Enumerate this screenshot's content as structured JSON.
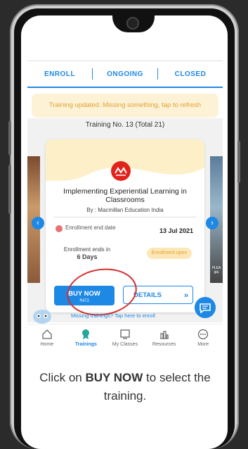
{
  "tabs": {
    "enroll": "ENROLL",
    "ongoing": "ONGOING",
    "closed": "CLOSED"
  },
  "banner": "Training updated. Missing something, tap to refresh",
  "training_no": "Training No. 13 (Total 21)",
  "card": {
    "logo_text": "macmillan education",
    "title": "Implementing Experiential Learning in Classrooms",
    "by": "By : Macmillan Education India",
    "end_label": "Enrollment end date",
    "end_date": "13 Jul 2021",
    "ends_in": "Enrollment ends in",
    "ends_days": "6 Days",
    "status_badge": "Enrollment open",
    "buy_label": "BUY NOW",
    "buy_price": "₹472",
    "details_label": "DETAILS",
    "details_chevron": "»"
  },
  "side_text": "PLEA gla",
  "missing_link": "Missing trainings? Tap here to enroll",
  "nav": [
    {
      "label": "Home",
      "icon": "home-icon"
    },
    {
      "label": "Trainings",
      "icon": "trainings-icon"
    },
    {
      "label": "My Classes",
      "icon": "classes-icon"
    },
    {
      "label": "Resources",
      "icon": "resources-icon"
    },
    {
      "label": "More",
      "icon": "more-icon"
    }
  ],
  "caption_pre": "Click on ",
  "caption_bold": "BUY NOW",
  "caption_post": " to select the training.",
  "colors": {
    "accent": "#1e88e5",
    "highlight": "#d32f2f",
    "banner_bg": "#fdf2d6"
  }
}
